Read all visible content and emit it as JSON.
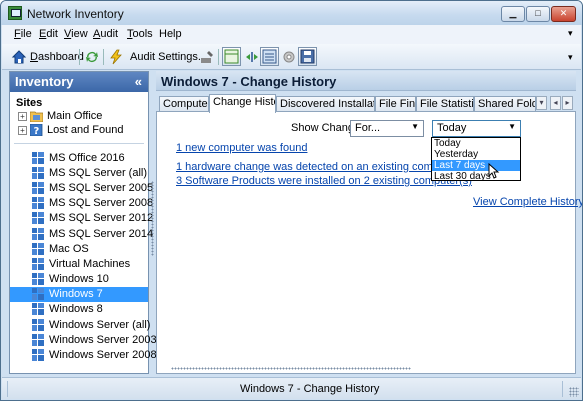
{
  "window": {
    "title": "Network Inventory"
  },
  "menu": [
    {
      "u": "F",
      "rest": "ile"
    },
    {
      "u": "E",
      "rest": "dit"
    },
    {
      "u": "V",
      "rest": "iew"
    },
    {
      "u": "A",
      "rest": "udit"
    },
    {
      "u": "T",
      "rest": "ools"
    },
    {
      "u": "",
      "rest": "Help"
    }
  ],
  "toolbar": {
    "dashboard_u": "D",
    "dashboard_rest": "ashboard",
    "audit_settings": "Audit Settings..."
  },
  "inventory": {
    "title": "Inventory",
    "collapse_glyph": "«",
    "sites_label": "Sites",
    "sites": [
      "Main Office",
      "Lost and Found"
    ],
    "items": [
      "MS Office 2016",
      "MS SQL Server (all)",
      "MS SQL Server 2005",
      "MS SQL Server 2008",
      "MS SQL Server 2012",
      "MS SQL Server 2014",
      "Mac OS",
      "Virtual Machines",
      "Windows 10",
      "Windows 7",
      "Windows 8",
      "Windows Server (all)",
      "Windows Server 2003",
      "Windows Server 2008"
    ],
    "selected": "Windows 7"
  },
  "main": {
    "title": "Windows 7 - Change History",
    "tabs": [
      "Computers",
      "Change History",
      "Discovered Installations",
      "File Find",
      "File Statistics",
      "Shared Folders"
    ],
    "active_tab": "Change History",
    "show_change_label": "Show Change:",
    "change_select_value": "For...",
    "period_select_value": "Today",
    "period_options": [
      "Today",
      "Yesterday",
      "Last 7 days",
      "Last 30 days"
    ],
    "highlighted_option": "Last 7 days",
    "links": [
      "1 new computer was found",
      "1 hardware change was detected on an existing computer",
      "3 Software Products were installed on 2 existing computer(s)"
    ],
    "view_complete": "View Complete History..."
  },
  "status": {
    "text": "Windows 7 - Change History"
  },
  "colors": {
    "selection": "#3399ff",
    "link": "#0645ad",
    "header": "#3b67a8"
  },
  "icons": [
    "app-icon",
    "home-icon",
    "refresh-icon",
    "lightning-icon",
    "wrench-icon",
    "window-icon",
    "gear-icon",
    "disk-icon",
    "folder-icon",
    "help-icon",
    "windows-logo-icon",
    "mouse-cursor-icon"
  ]
}
